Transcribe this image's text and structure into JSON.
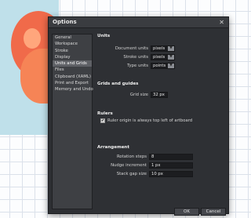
{
  "dialog": {
    "title": "Options",
    "close_glyph": "✕"
  },
  "categories": [
    {
      "label": "General",
      "selected": false
    },
    {
      "label": "Workspace",
      "selected": false
    },
    {
      "label": "Stroke",
      "selected": false
    },
    {
      "label": "Display",
      "selected": false
    },
    {
      "label": "Units and Grids",
      "selected": true
    },
    {
      "label": "Files",
      "selected": false
    },
    {
      "label": "Clipboard (XAML)",
      "selected": false
    },
    {
      "label": "Print and Export",
      "selected": false
    },
    {
      "label": "Memory and Undo",
      "selected": false
    }
  ],
  "units": {
    "title": "Units",
    "document_label": "Document units",
    "document_value": "pixels",
    "stroke_label": "Stroke units",
    "stroke_value": "pixels",
    "type_label": "Type units",
    "type_value": "points"
  },
  "grids": {
    "title": "Grids and guides",
    "grid_size_label": "Grid size",
    "grid_size_value": "32 px"
  },
  "rulers": {
    "title": "Rulers",
    "checkbox_label": "Ruler origin is always top left of artboard",
    "checked": true,
    "check_glyph": "✔"
  },
  "arrangement": {
    "title": "Arrangement",
    "rotation_label": "Rotation steps",
    "rotation_value": "8",
    "nudge_label": "Nudge increment",
    "nudge_value": "1 px",
    "stack_label": "Stack gap size",
    "stack_value": "10 px"
  },
  "buttons": {
    "ok": "OK",
    "cancel": "Cancel"
  },
  "dropdown_arrow": "▼"
}
